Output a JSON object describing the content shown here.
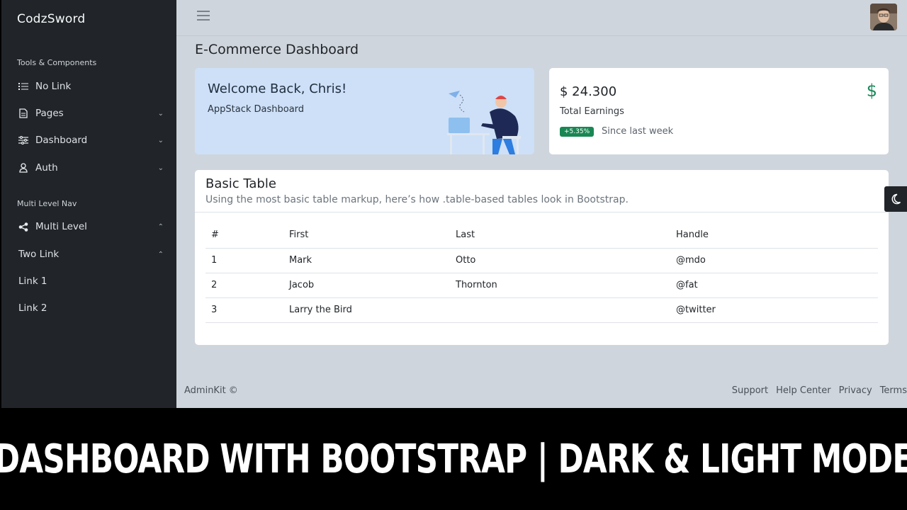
{
  "sidebar": {
    "brand": "CodzSword",
    "section1": "Tools & Components",
    "items1": [
      {
        "label": "No Link",
        "icon": "list-icon"
      },
      {
        "label": "Pages",
        "icon": "file-icon"
      },
      {
        "label": "Dashboard",
        "icon": "sliders-icon"
      },
      {
        "label": "Auth",
        "icon": "user-icon"
      }
    ],
    "section2": "Multi Level Nav",
    "multi_level": "Multi Level",
    "two_link": "Two Link",
    "link1": "Link 1",
    "link2": "Link 2"
  },
  "header": {
    "page_title": "E-Commerce Dashboard"
  },
  "welcome": {
    "title": "Welcome Back, Chris!",
    "subtitle": "AppStack Dashboard"
  },
  "earnings": {
    "amount": "$ 24.300",
    "label": "Total Earnings",
    "badge": "+5.35%",
    "since": "Since last week",
    "icon": "$"
  },
  "table": {
    "title": "Basic Table",
    "description": "Using the most basic table markup, here’s how .table-based tables look in Bootstrap.",
    "columns": [
      "#",
      "First",
      "Last",
      "Handle"
    ],
    "rows": [
      [
        "1",
        "Mark",
        "Otto",
        "@mdo"
      ],
      [
        "2",
        "Jacob",
        "Thornton",
        "@fat"
      ],
      [
        "3",
        "Larry the Bird",
        "",
        "@twitter"
      ]
    ]
  },
  "footer": {
    "left": "AdminKit ©",
    "links": [
      "Support",
      "Help Center",
      "Privacy",
      "Terms"
    ]
  },
  "banner": "DASHBOARD WITH BOOTSTRAP | DARK & LIGHT MODE"
}
